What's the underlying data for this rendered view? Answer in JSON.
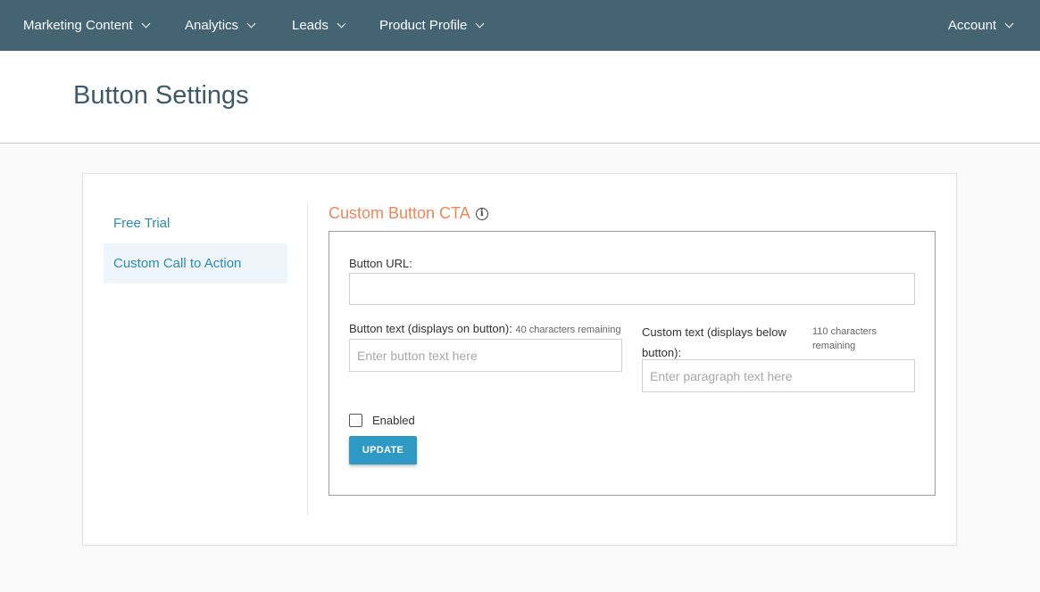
{
  "nav": {
    "items": [
      {
        "label": "Marketing Content"
      },
      {
        "label": "Analytics"
      },
      {
        "label": "Leads"
      },
      {
        "label": "Product Profile"
      }
    ],
    "account": {
      "label": "Account"
    }
  },
  "header": {
    "title": "Button Settings"
  },
  "sidebar": {
    "items": [
      {
        "label": "Free Trial",
        "active": false
      },
      {
        "label": "Custom Call to Action",
        "active": true
      }
    ]
  },
  "section": {
    "title": "Custom Button CTA",
    "info_icon": "info-circle-icon"
  },
  "form": {
    "button_url": {
      "label": "Button URL:",
      "value": "",
      "placeholder": ""
    },
    "button_text": {
      "label": "Button text (displays on button):",
      "remaining": "40 characters remaining",
      "value": "",
      "placeholder": "Enter button text here"
    },
    "custom_text": {
      "label_line1": "Custom text (displays below",
      "label_line2": "button):",
      "remaining_line1": "110 characters",
      "remaining_line2": "remaining",
      "value": "",
      "placeholder": "Enter paragraph text here"
    },
    "enabled": {
      "label": "Enabled",
      "checked": false
    },
    "update_button": "UPDATE"
  },
  "colors": {
    "nav_bg": "#446373",
    "accent": "#2e99c2",
    "section_title": "#ef8659",
    "title_text": "#3e5a69"
  }
}
